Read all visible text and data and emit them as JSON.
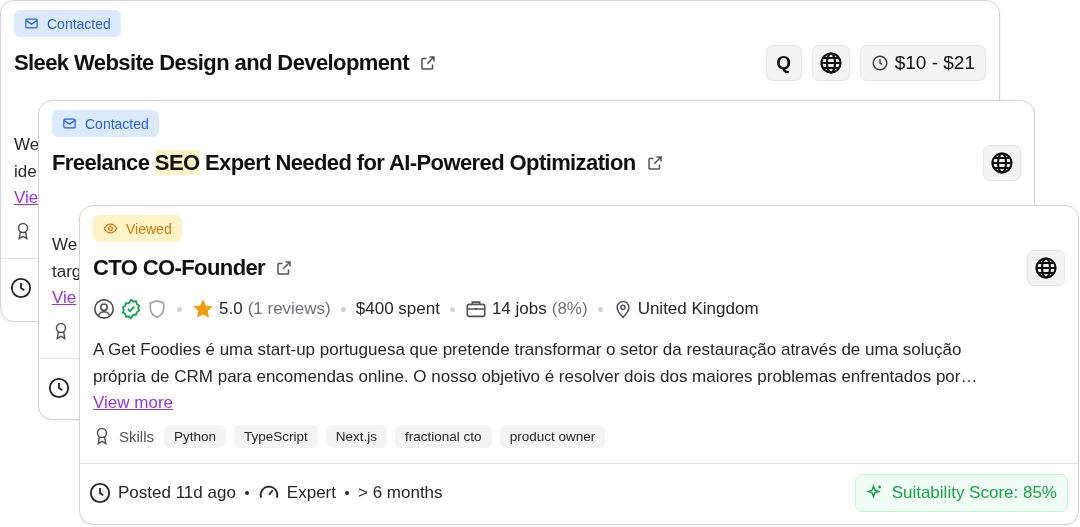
{
  "cards": [
    {
      "status": {
        "kind": "contacted",
        "label": "Contacted"
      },
      "title_parts": [
        {
          "text": "Sleek Website Design and Development",
          "highlighted": false
        }
      ],
      "actions": [
        {
          "kind": "text",
          "label": "Q"
        },
        {
          "kind": "globe"
        },
        {
          "kind": "rate",
          "label": "$10 - $21"
        }
      ],
      "description_lines": [
        "We",
        "ide"
      ],
      "view_more": "Vie"
    },
    {
      "status": {
        "kind": "contacted",
        "label": "Contacted"
      },
      "title_parts": [
        {
          "text": "Freelance ",
          "highlighted": false
        },
        {
          "text": "SEO",
          "highlighted": true
        },
        {
          "text": " Expert Needed for AI-Powered Optimization",
          "highlighted": false
        }
      ],
      "actions": [
        {
          "kind": "globe"
        }
      ],
      "description_lines": [
        "We",
        "targ"
      ],
      "view_more": "Vie"
    },
    {
      "status": {
        "kind": "viewed",
        "label": "Viewed"
      },
      "title_parts": [
        {
          "text": "CTO CO-Founder",
          "highlighted": false
        }
      ],
      "actions": [
        {
          "kind": "globe"
        }
      ],
      "payment_verified": true,
      "identity_verified": false,
      "rating": "5.0",
      "reviews": "(1 reviews)",
      "spent": "$400 spent",
      "jobs": "14 jobs",
      "jobs_rate": "(8%)",
      "location": "United Kingdom",
      "description_lines": [
        "A Get Foodies é uma start-up portuguesa que pretende transformar o setor da restauração através de uma solução",
        "própria de CRM para encomendas online. O nosso objetivo é resolver dois dos maiores problemas enfrentados por…"
      ],
      "view_more": "View more",
      "skills_label": "Skills",
      "skills": [
        "Python",
        "TypeScript",
        "Next.js",
        "fractional cto",
        "product owner"
      ],
      "posted": "Posted 11d ago",
      "level": "Expert",
      "duration": "> 6 months",
      "score": "Suitability Score: 85%"
    }
  ]
}
